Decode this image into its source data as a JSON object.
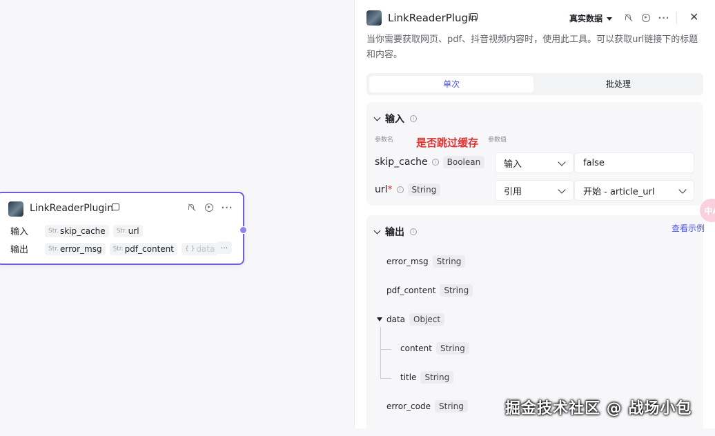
{
  "node": {
    "title": "LinkReaderPlugin",
    "input_label": "输入",
    "output_label": "输出",
    "inputs": [
      {
        "type": "Str.",
        "name": "skip_cache"
      },
      {
        "type": "Str.",
        "name": "url"
      }
    ],
    "outputs": [
      {
        "type": "Str.",
        "name": "error_msg"
      },
      {
        "type": "Str.",
        "name": "pdf_content"
      },
      {
        "type": "{ }",
        "name": "data"
      }
    ],
    "more": "···"
  },
  "panel": {
    "title": "LinkReaderPlugin",
    "mode": "真实数据",
    "description": "当你需要获取网页、pdf、抖音视频内容时，使用此工具。可以获取url链接下的标题和内容。",
    "tabs": {
      "single": "单次",
      "batch": "批处理"
    },
    "input_section": {
      "title": "输入",
      "col_name": "参数名",
      "col_value": "参数值",
      "annotation": "是否跳过缓存",
      "params": [
        {
          "name": "skip_cache",
          "required": "",
          "type": "Boolean",
          "source": "输入",
          "value": "false"
        },
        {
          "name": "url",
          "required": "*",
          "type": "String",
          "source": "引用",
          "value": "开始 - article_url"
        }
      ]
    },
    "output_section": {
      "title": "输出",
      "example_link": "查看示例",
      "fields": [
        {
          "name": "error_msg",
          "type": "String"
        },
        {
          "name": "pdf_content",
          "type": "String"
        },
        {
          "name": "data",
          "type": "Object"
        },
        {
          "name": "content",
          "type": "String"
        },
        {
          "name": "title",
          "type": "String"
        },
        {
          "name": "error_code",
          "type": "String"
        }
      ]
    },
    "float_button": "中A"
  },
  "watermark": "掘金技术社区 @ 战场小包"
}
